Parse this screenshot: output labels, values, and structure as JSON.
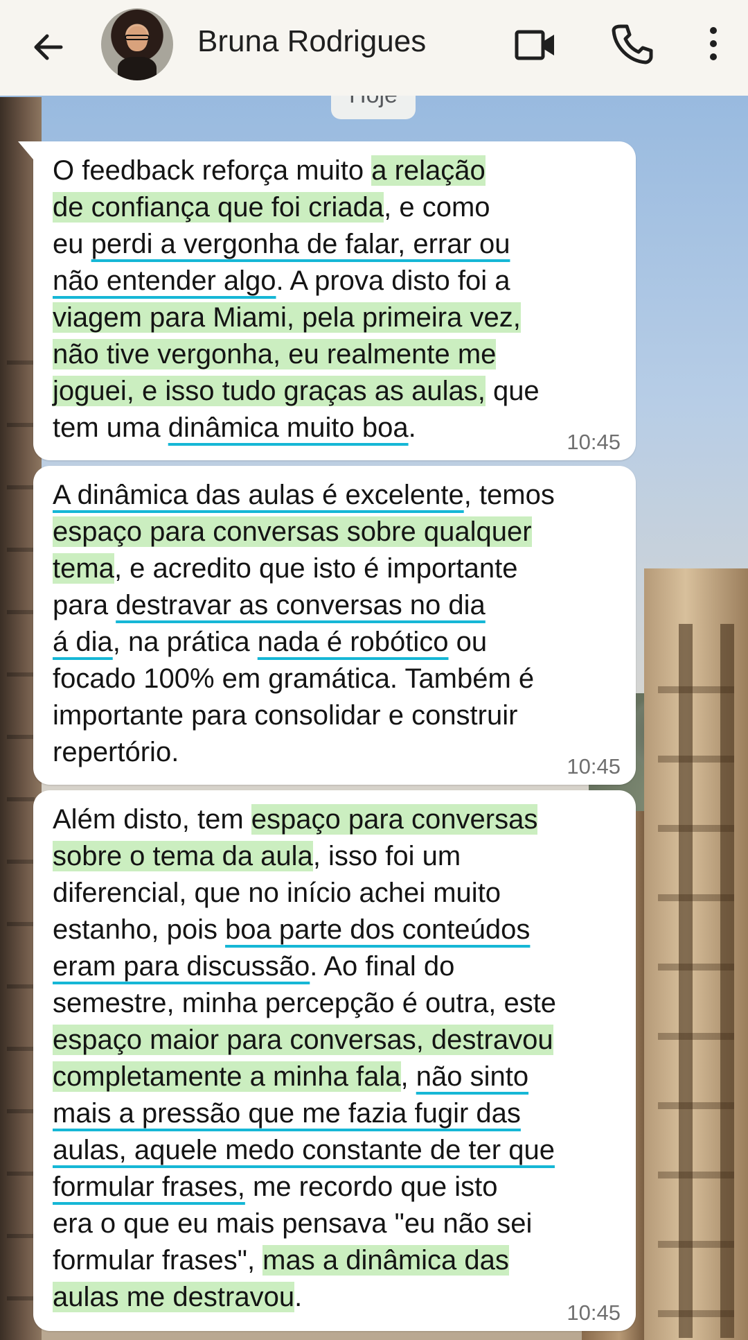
{
  "header": {
    "contact_name": "Bruna Rodrigues",
    "icons": [
      "back-arrow-icon",
      "avatar",
      "video-call-icon",
      "phone-icon",
      "more-vert-icon"
    ]
  },
  "date_chip": "Hoje",
  "colors": {
    "highlight": "#cbeec0",
    "underline": "#16b7d6",
    "bubble": "#ffffff",
    "header": "#f7f5f0"
  },
  "messages": [
    {
      "time": "10:45",
      "lines": [
        [
          {
            "t": "O feedback reforça muito "
          },
          {
            "t": "a relação",
            "s": "hl"
          }
        ],
        [
          {
            "t": "de confiança que foi criada",
            "s": "hl"
          },
          {
            "t": ", e como"
          }
        ],
        [
          {
            "t": "eu "
          },
          {
            "t": "perdi a vergonha de falar, errar ou",
            "s": "ul"
          }
        ],
        [
          {
            "t": "não entender algo",
            "s": "ul"
          },
          {
            "t": ". A prova disto foi a"
          }
        ],
        [
          {
            "t": "viagem para Miami, pela primeira vez,",
            "s": "hl"
          }
        ],
        [
          {
            "t": "não tive vergonha, eu realmente me",
            "s": "hl"
          }
        ],
        [
          {
            "t": "joguei, e isso tudo graças as aulas,",
            "s": "hl"
          },
          {
            "t": " que"
          }
        ],
        [
          {
            "t": "tem uma "
          },
          {
            "t": "dinâmica muito boa",
            "s": "ul"
          },
          {
            "t": "."
          }
        ]
      ]
    },
    {
      "time": "10:45",
      "lines": [
        [
          {
            "t": "A dinâmica das aulas é excelente",
            "s": "ul"
          },
          {
            "t": ", temos"
          }
        ],
        [
          {
            "t": "espaço para conversas sobre qualquer",
            "s": "hl"
          }
        ],
        [
          {
            "t": "tema",
            "s": "hl"
          },
          {
            "t": ", e acredito que isto é importante"
          }
        ],
        [
          {
            "t": "para "
          },
          {
            "t": "destravar as conversas no dia",
            "s": "ul"
          }
        ],
        [
          {
            "t": "á dia",
            "s": "ul"
          },
          {
            "t": ", na prática "
          },
          {
            "t": "nada é robótico",
            "s": "ul"
          },
          {
            "t": " ou"
          }
        ],
        [
          {
            "t": "focado 100% em gramática. Também é"
          }
        ],
        [
          {
            "t": "importante para consolidar e construir"
          }
        ],
        [
          {
            "t": "repertório."
          }
        ]
      ]
    },
    {
      "time": "10:45",
      "lines": [
        [
          {
            "t": "Além disto, tem "
          },
          {
            "t": "espaço para conversas",
            "s": "hl"
          }
        ],
        [
          {
            "t": "sobre o tema da aula",
            "s": "hl"
          },
          {
            "t": ", isso foi um"
          }
        ],
        [
          {
            "t": "diferencial, que no início achei muito"
          }
        ],
        [
          {
            "t": "estanho, pois "
          },
          {
            "t": "boa parte dos conteúdos",
            "s": "ul"
          }
        ],
        [
          {
            "t": "eram para discussão",
            "s": "ul"
          },
          {
            "t": ". Ao final do"
          }
        ],
        [
          {
            "t": "semestre, minha percepção é outra, este"
          }
        ],
        [
          {
            "t": "espaço maior para conversas, destravou",
            "s": "hl"
          }
        ],
        [
          {
            "t": "completamente a minha fala",
            "s": "hl"
          },
          {
            "t": ", "
          },
          {
            "t": "não sinto",
            "s": "ul"
          }
        ],
        [
          {
            "t": "mais a pressão que me fazia fugir das",
            "s": "ul"
          }
        ],
        [
          {
            "t": "aulas, aquele medo constante de ter que",
            "s": "ul"
          }
        ],
        [
          {
            "t": "formular frases,",
            "s": "ul"
          },
          {
            "t": " me recordo que isto"
          }
        ],
        [
          {
            "t": "era o que eu mais pensava \"eu não sei"
          }
        ],
        [
          {
            "t": "formular frases\", "
          },
          {
            "t": "mas a dinâmica das",
            "s": "hl"
          }
        ],
        [
          {
            "t": "aulas me destravou",
            "s": "hl"
          },
          {
            "t": "."
          }
        ]
      ]
    }
  ]
}
